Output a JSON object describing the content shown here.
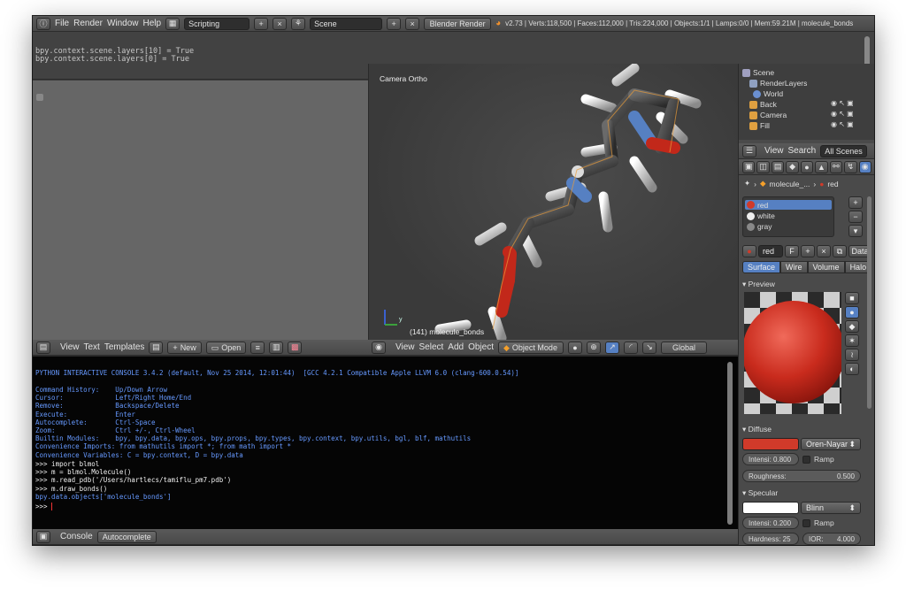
{
  "top_bar": {
    "menus": [
      "File",
      "Render",
      "Window",
      "Help"
    ],
    "screen_layout": "Scripting",
    "scene": "Scene",
    "render_engine": "Blender Render",
    "stats": "v2.73 | Verts:118,500 | Faces:112,000 | Tris:224,000 | Objects:1/1 | Lamps:0/0 | Mem:59.21M | molecule_bonds"
  },
  "info": {
    "lines": [
      "bpy.context.scene.layers[10] = True",
      "bpy.context.scene.layers[0] = True"
    ]
  },
  "viewport": {
    "view_name": "Camera Ortho",
    "object_label": "(141) molecule_bonds",
    "axis_y": "y"
  },
  "text_editor_header": {
    "menus": [
      "View",
      "Text",
      "Templates"
    ],
    "new_label": "New",
    "open_label": "Open"
  },
  "viewport_header": {
    "menus": [
      "View",
      "Select",
      "Add",
      "Object"
    ],
    "mode": "Object Mode",
    "orientation": "Global"
  },
  "console": {
    "banner": "PYTHON INTERACTIVE CONSOLE 3.4.2 (default, Nov 25 2014, 12:01:44)  [GCC 4.2.1 Compatible Apple LLVM 6.0 (clang-600.0.54)]",
    "help_lines": [
      "Command History:    Up/Down Arrow",
      "Cursor:             Left/Right Home/End",
      "Remove:             Backspace/Delete",
      "Execute:            Enter",
      "Autocomplete:       Ctrl-Space",
      "Zoom:               Ctrl +/-, Ctrl-Wheel",
      "Builtin Modules:    bpy, bpy.data, bpy.ops, bpy.props, bpy.types, bpy.context, bpy.utils, bgl, blf, mathutils",
      "Convenience Imports: from mathutils import *; from math import *",
      "Convenience Variables: C = bpy.context, D = bpy.data"
    ],
    "commands": [
      ">>> import blmol",
      ">>> m = blmol.Molecule()",
      ">>> m.read_pdb('/Users/hartlecs/tamiflu_pm7.pdb')",
      ">>> m.draw_bonds()"
    ],
    "output": "bpy.data.objects['molecule_bonds']",
    "prompt": ">>> "
  },
  "console_header": {
    "tabs": [
      "Console",
      "Autocomplete"
    ]
  },
  "outliner": {
    "items": [
      "Scene",
      "RenderLayers",
      "World",
      "Back",
      "Camera",
      "Fill"
    ],
    "header_menus": [
      "View",
      "Search"
    ],
    "filter": "All Scenes"
  },
  "properties": {
    "breadcrumb_object": "molecule_...",
    "breadcrumb_material": "red",
    "materials": [
      "red",
      "white",
      "gray"
    ],
    "material_name": "red",
    "fake_user": "F",
    "link": "Data",
    "tabs": [
      "Surface",
      "Wire",
      "Volume",
      "Halo"
    ],
    "preview_title": "Preview",
    "diffuse_title": "Diffuse",
    "diffuse_shader": "Oren-Nayar",
    "diffuse_intensity": "Intensi: 0.800",
    "ramp_label": "Ramp",
    "roughness_label": "Roughness:",
    "roughness_value": "0.500",
    "specular_title": "Specular",
    "specular_shader": "Blinn",
    "specular_intensity": "Intensi: 0.200",
    "specular_ramp_label": "Ramp",
    "hardness_label": "Hardness: 25",
    "ior_label": "IOR:",
    "ior_value": "4.000",
    "colors": {
      "diffuse": "#d03a2a",
      "specular": "#ffffff",
      "accent": "#5680c2"
    }
  }
}
